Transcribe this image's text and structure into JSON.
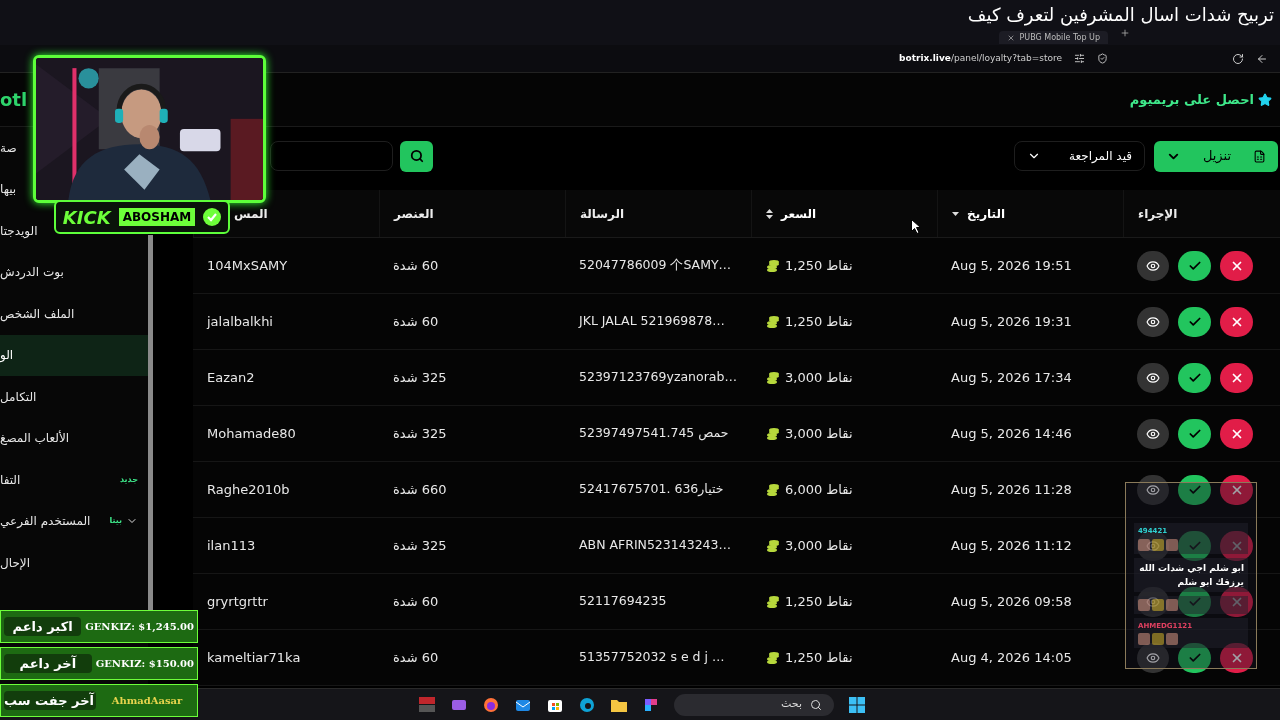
{
  "stream_title": "تربيح شدات اسال المشرفين لتعرف كيف",
  "browser": {
    "tab": "PUBG Mobile Top Up",
    "url_host": "botrix.live",
    "url_path": "/panel/loyalty?tab=store"
  },
  "header": {
    "logo": "otl",
    "premium": "احصل على بريميوم"
  },
  "sidebar": {
    "items": [
      {
        "label": "صة",
        "selected": false,
        "has_submenu": false
      },
      {
        "label": "بيها",
        "selected": false,
        "has_submenu": false
      },
      {
        "label": "الويدجتا",
        "selected": false,
        "has_submenu": false
      },
      {
        "label": "بوت الدردش",
        "selected": false,
        "has_submenu": false
      },
      {
        "label": "الملف الشخص",
        "selected": false,
        "has_submenu": false
      },
      {
        "label": "الو",
        "selected": true,
        "has_submenu": false
      },
      {
        "label": "التكامل",
        "selected": false,
        "has_submenu": false
      },
      {
        "label": "الألعاب المصغ",
        "selected": false,
        "has_submenu": false
      },
      {
        "label": "التفا",
        "selected": false,
        "has_submenu": false,
        "badge": "جديد"
      },
      {
        "label": "المستخدم الفرعي",
        "selected": false,
        "has_submenu": true,
        "badge": "بيتا"
      },
      {
        "label": "الإحال",
        "selected": false,
        "has_submenu": false
      }
    ]
  },
  "toolbar": {
    "status_filter": "قيد المراجعة",
    "download": "تنزيل"
  },
  "table": {
    "columns": [
      {
        "label": "الإجراء",
        "sortable": false,
        "sorted": false
      },
      {
        "label": "التاريخ",
        "sortable": true,
        "sorted": true
      },
      {
        "label": "السعر",
        "sortable": true,
        "sorted": false
      },
      {
        "label": "الرسالة",
        "sortable": false,
        "sorted": false
      },
      {
        "label": "العنصر",
        "sortable": false,
        "sorted": false
      },
      {
        "label": "المس",
        "sortable": false,
        "sorted": false
      }
    ],
    "rows": [
      {
        "user": "104MxSAMY",
        "item": "60 شدة",
        "message": "52047786009 个SAMY…",
        "price": "نقاط 1,250",
        "date": "Aug 5, 2026 19:51"
      },
      {
        "user": "jalalbalkhi",
        "item": "60 شدة",
        "message": "JKL JALAL 521969878…",
        "price": "نقاط 1,250",
        "date": "Aug 5, 2026 19:31"
      },
      {
        "user": "Eazan2",
        "item": "325 شدة",
        "message": "52397123769yzanorab…",
        "price": "نقاط 3,000",
        "date": "Aug 5, 2026 17:34"
      },
      {
        "user": "Mohamade80",
        "item": "325 شدة",
        "message": "52397497541.745 حمص",
        "price": "نقاط 3,000",
        "date": "Aug 5, 2026 14:46"
      },
      {
        "user": "Raghe2010b",
        "item": "660 شدة",
        "message": "52417675701. ختيار636",
        "price": "نقاط 6,000",
        "date": "Aug 5, 2026 11:28"
      },
      {
        "user": "ilan113",
        "item": "325 شدة",
        "message": "ABN AFRIN523143243…",
        "price": "نقاط 3,000",
        "date": "Aug 5, 2026 11:12"
      },
      {
        "user": "gryrtgrttr",
        "item": "60 شدة",
        "message": "52117694235",
        "price": "نقاط 1,250",
        "date": "Aug 5, 2026 09:58"
      },
      {
        "user": "kameltiar71ka",
        "item": "60 شدة",
        "message": "51357752032 s e d j …",
        "price": "نقاط 1,250",
        "date": "Aug 4, 2026 14:05"
      }
    ]
  },
  "webcam": {
    "platform": "KICK",
    "channel": "ABOSHAM"
  },
  "alerts": [
    {
      "label": "اكبر داعم",
      "value": "GENKIZ: $1,245.00",
      "color": "#ffffff"
    },
    {
      "label": "آخر داعم",
      "value": "GENKIZ: $150.00",
      "color": "#ffffff"
    },
    {
      "label": "آخر جفت سب",
      "value": "AhmadAasar",
      "color": "#e8d44d"
    }
  ],
  "chat": [
    {
      "kind": "emotes",
      "user": "494421"
    },
    {
      "kind": "text",
      "text": "ابو شلم اجي شدات الله يرزقك ابو شلم"
    },
    {
      "kind": "emotes"
    },
    {
      "kind": "emotes",
      "user": "AHMEDG1121"
    }
  ],
  "taskbar": {
    "search": "بحث"
  }
}
